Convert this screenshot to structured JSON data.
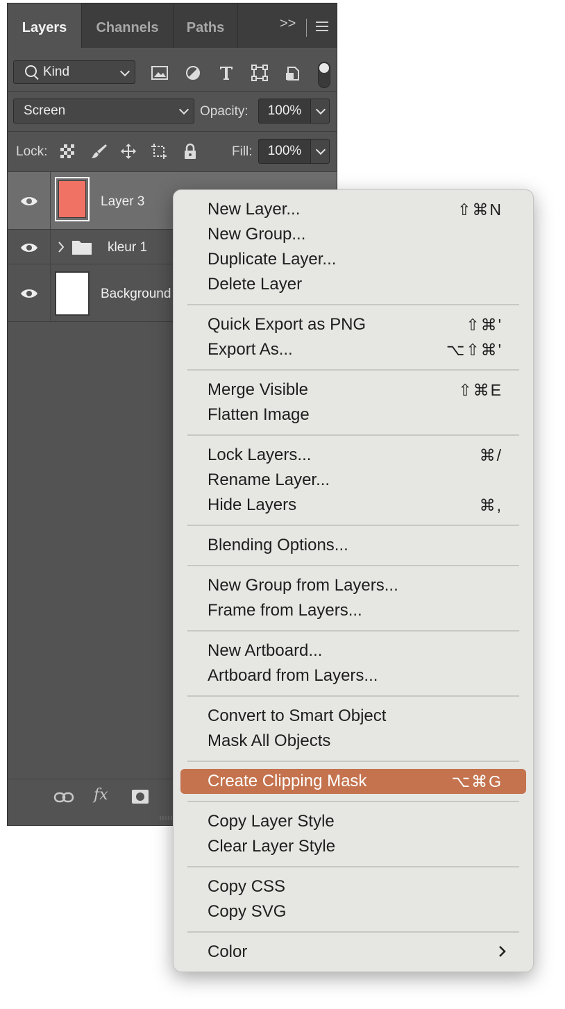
{
  "panel": {
    "tabs": [
      {
        "label": "Layers",
        "active": true
      },
      {
        "label": "Channels",
        "active": false
      },
      {
        "label": "Paths",
        "active": false
      }
    ],
    "overflow_label": ">>",
    "filter": {
      "kind_label": "Kind"
    },
    "blend_mode": "Screen",
    "opacity_label": "Opacity:",
    "opacity_value": "100%",
    "lock_label": "Lock:",
    "fill_label": "Fill:",
    "fill_value": "100%",
    "layers": [
      {
        "name": "Layer 3",
        "thumb_color": "#ef7264",
        "selected": true
      },
      {
        "name": "kleur 1",
        "type": "group"
      },
      {
        "name": "Background",
        "thumb_color": "#ffffff"
      }
    ],
    "bottom_fx_label": "fx"
  },
  "menu": {
    "groups": [
      [
        {
          "label": "New Layer...",
          "shortcut": "⇧⌘N"
        },
        {
          "label": "New Group...",
          "shortcut": ""
        },
        {
          "label": "Duplicate Layer...",
          "shortcut": ""
        },
        {
          "label": "Delete Layer",
          "shortcut": ""
        }
      ],
      [
        {
          "label": "Quick Export as PNG",
          "shortcut": "⇧⌘'"
        },
        {
          "label": "Export As...",
          "shortcut": "⌥⇧⌘'"
        }
      ],
      [
        {
          "label": "Merge Visible",
          "shortcut": "⇧⌘E"
        },
        {
          "label": "Flatten Image",
          "shortcut": ""
        }
      ],
      [
        {
          "label": "Lock Layers...",
          "shortcut": "⌘/"
        },
        {
          "label": "Rename Layer...",
          "shortcut": ""
        },
        {
          "label": "Hide Layers",
          "shortcut": "⌘,"
        }
      ],
      [
        {
          "label": "Blending Options...",
          "shortcut": ""
        }
      ],
      [
        {
          "label": "New Group from Layers...",
          "shortcut": ""
        },
        {
          "label": "Frame from Layers...",
          "shortcut": ""
        }
      ],
      [
        {
          "label": "New Artboard...",
          "shortcut": ""
        },
        {
          "label": "Artboard from Layers...",
          "shortcut": ""
        }
      ],
      [
        {
          "label": "Convert to Smart Object",
          "shortcut": ""
        },
        {
          "label": "Mask All Objects",
          "shortcut": ""
        }
      ],
      [
        {
          "label": "Create Clipping Mask",
          "shortcut": "⌥⌘G",
          "highlighted": true
        }
      ],
      [
        {
          "label": "Copy Layer Style",
          "shortcut": ""
        },
        {
          "label": "Clear Layer Style",
          "shortcut": ""
        }
      ],
      [
        {
          "label": "Copy CSS",
          "shortcut": ""
        },
        {
          "label": "Copy SVG",
          "shortcut": ""
        }
      ],
      [
        {
          "label": "Color",
          "shortcut": "",
          "submenu": true
        }
      ]
    ],
    "highlight_color": "#c4734e"
  }
}
